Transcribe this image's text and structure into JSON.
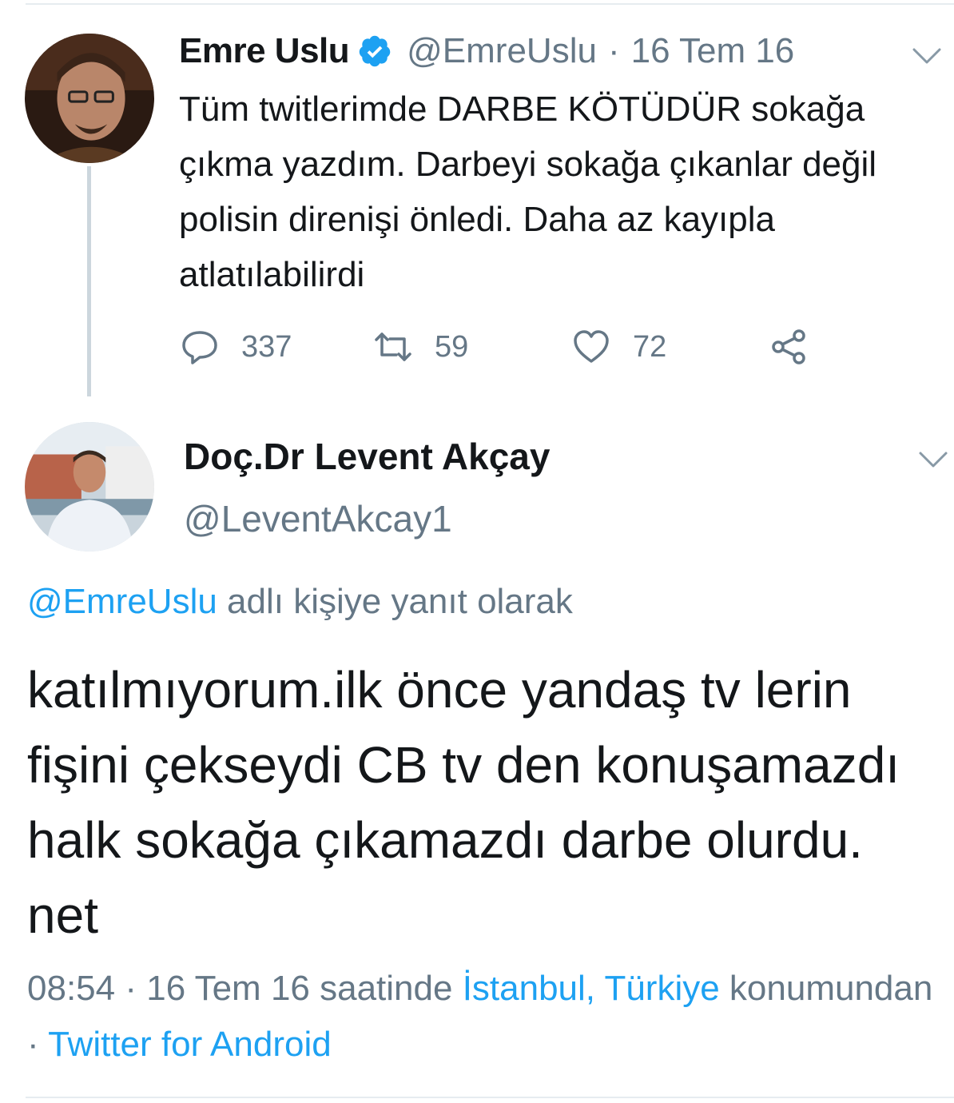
{
  "tweet": {
    "author_name": "Emre Uslu",
    "handle": "@EmreUslu",
    "separator": "·",
    "date": "16 Tem 16",
    "text": "Tüm twitlerimde DARBE KÖTÜDÜR sokağa çıkma yazdım. Darbeyi sokağa çıkanlar değil polisin direnişi önledi. Daha az kayıpla atlatılabilirdi",
    "verified": true,
    "stats": {
      "replies": "337",
      "retweets": "59",
      "likes": "72"
    },
    "icons": [
      "verified-badge-icon",
      "chevron-down-icon",
      "reply-icon",
      "retweet-icon",
      "like-icon",
      "share-icon"
    ]
  },
  "reply": {
    "author_name": "Doç.Dr Levent Akçay",
    "handle": "@LeventAkcay1",
    "replying_to_mention": "@EmreUslu",
    "replying_to_suffix": " adlı kişiye yanıt olarak",
    "text": "katılmıyorum.ilk önce yandaş tv lerin fişini çekseydi CB tv den konuşamazdı halk sokağa çıkamazdı darbe olurdu. net",
    "time": "08:54",
    "meta_separator": " · ",
    "date_phrase": "16 Tem 16 saatinde ",
    "location": "İstanbul, Türkiye",
    "location_suffix": " konumundan",
    "source_separator": " · ",
    "source": "Twitter for Android",
    "icons": [
      "chevron-down-icon"
    ]
  },
  "colors": {
    "text": "#14171a",
    "secondary": "#657786",
    "link": "#1da1f2",
    "thread_line": "#ccd6dd",
    "divider": "#e6ecf0"
  }
}
